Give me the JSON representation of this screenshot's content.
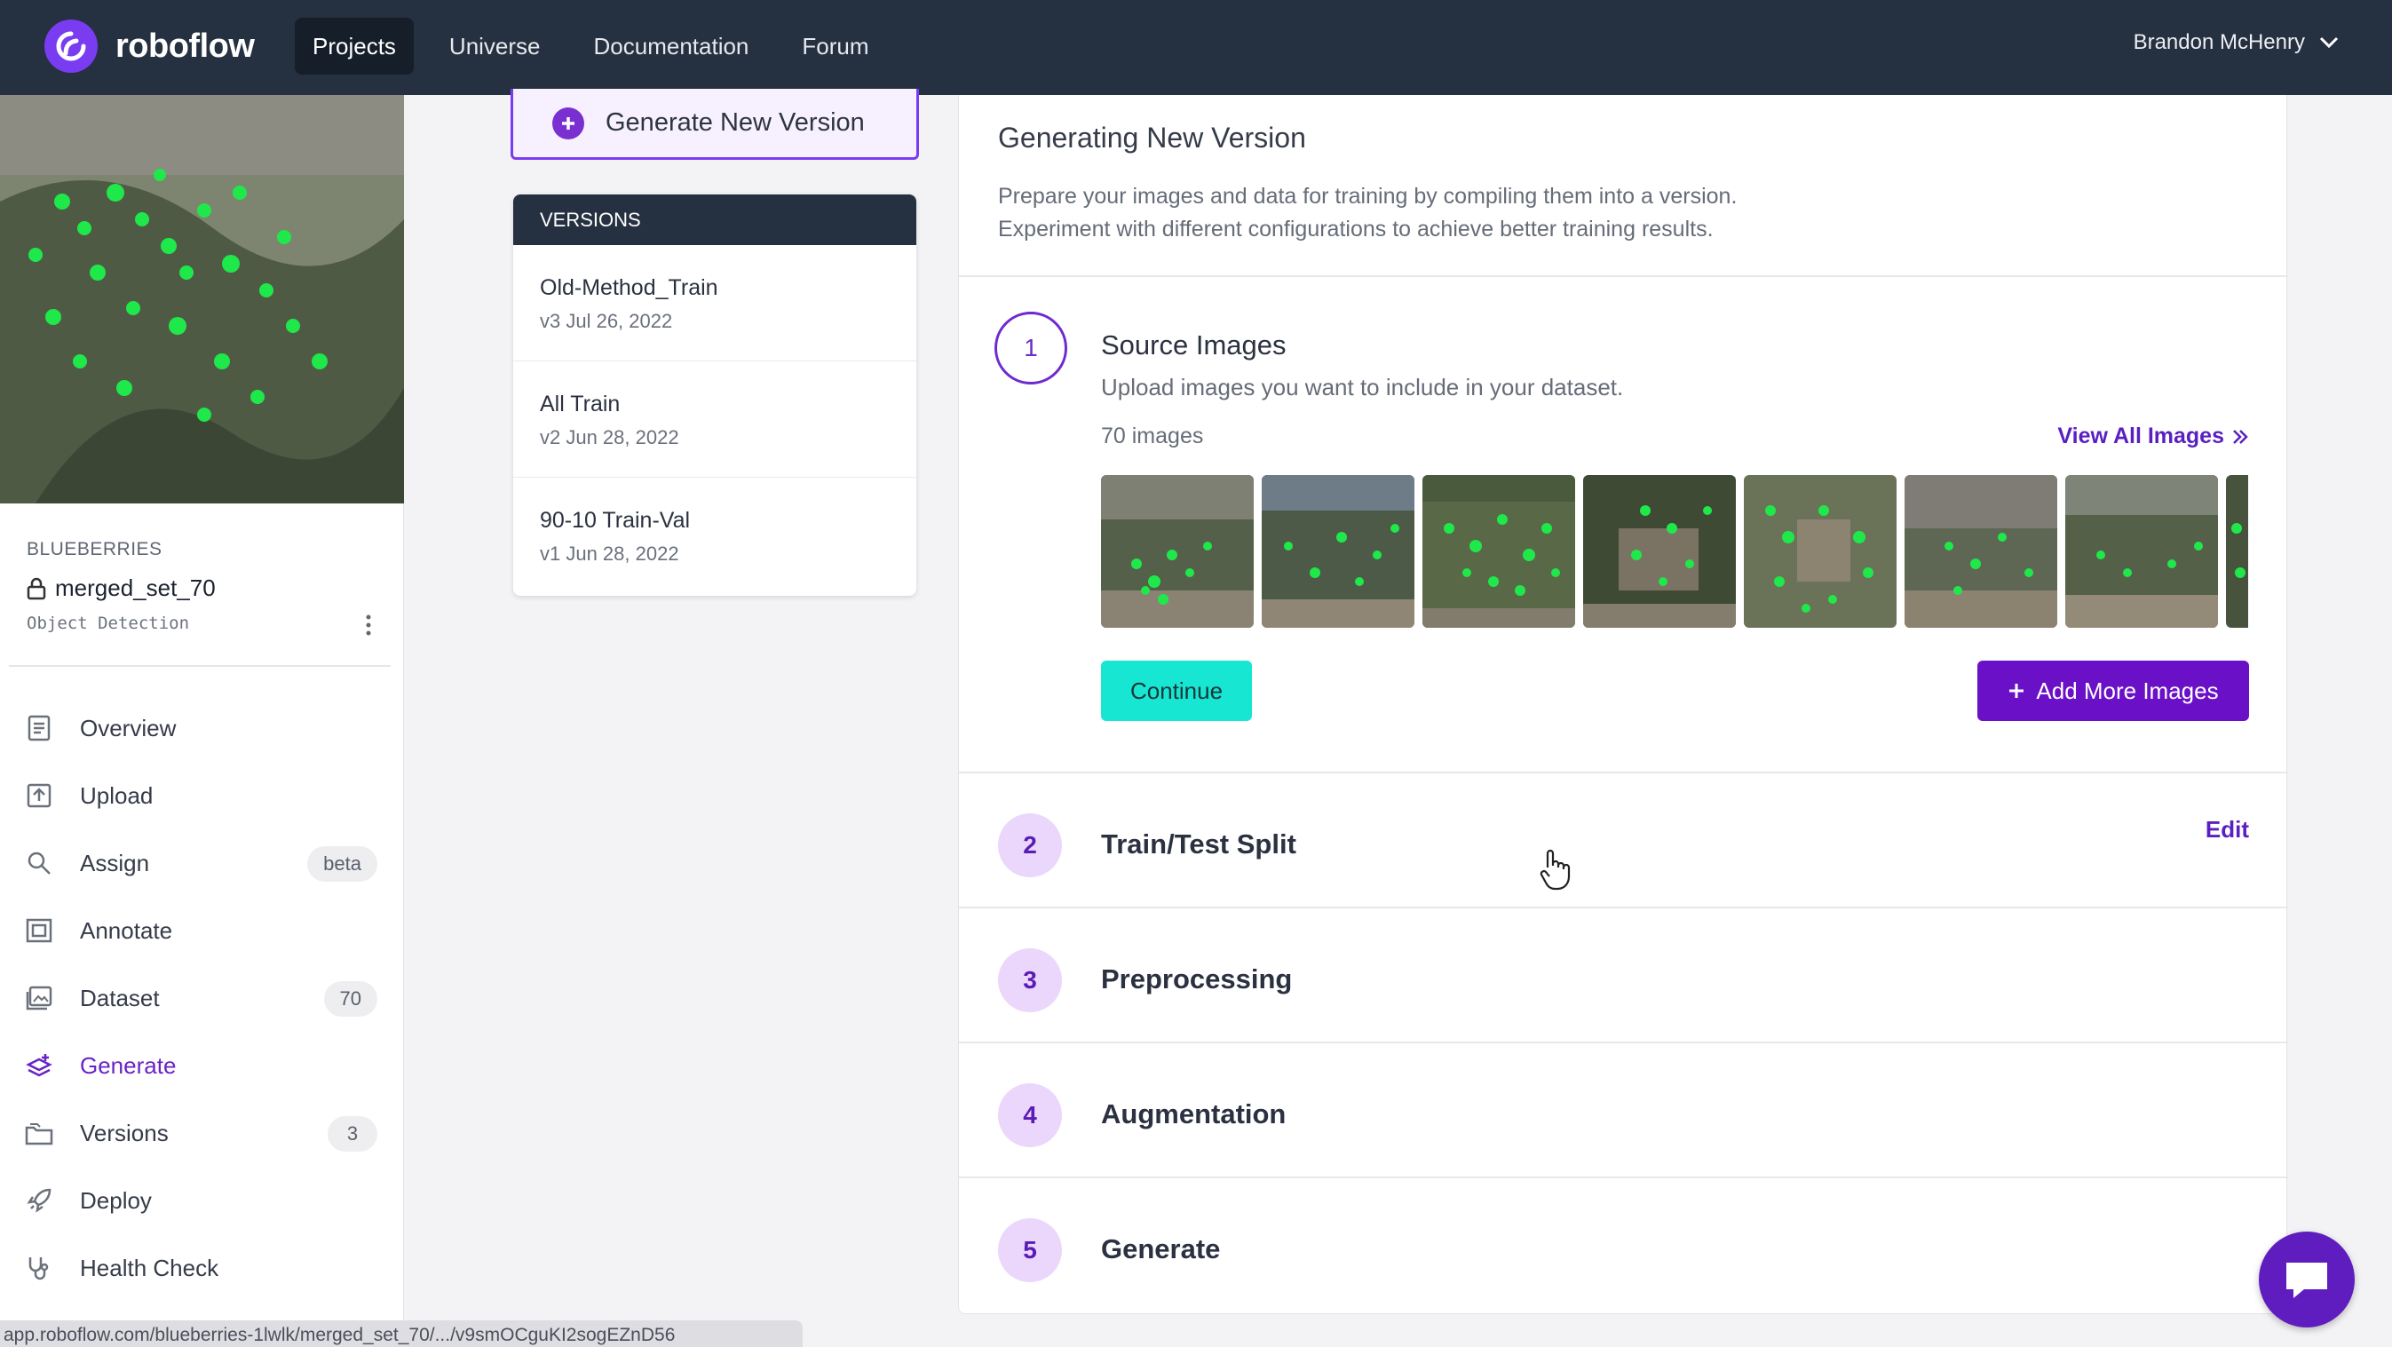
{
  "topbar": {
    "brand": "roboflow",
    "nav": [
      "Projects",
      "Universe",
      "Documentation",
      "Forum"
    ],
    "active_nav": "Projects",
    "user_name": "Brandon McHenry"
  },
  "sidebar": {
    "project_category": "BLUEBERRIES",
    "project_name": "merged_set_70",
    "project_type": "Object Detection",
    "items": [
      {
        "label": "Overview",
        "icon": "overview-icon",
        "badge": ""
      },
      {
        "label": "Upload",
        "icon": "upload-icon",
        "badge": ""
      },
      {
        "label": "Assign",
        "icon": "search-icon",
        "badge": "beta"
      },
      {
        "label": "Annotate",
        "icon": "annotate-icon",
        "badge": ""
      },
      {
        "label": "Dataset",
        "icon": "dataset-icon",
        "badge": "70"
      },
      {
        "label": "Generate",
        "icon": "generate-icon",
        "badge": ""
      },
      {
        "label": "Versions",
        "icon": "versions-icon",
        "badge": "3"
      },
      {
        "label": "Deploy",
        "icon": "rocket-icon",
        "badge": ""
      },
      {
        "label": "Health Check",
        "icon": "stethoscope-icon",
        "badge": ""
      }
    ],
    "active_item": "Generate"
  },
  "versions": {
    "generate_button": "Generate New Version",
    "header": "VERSIONS",
    "list": [
      {
        "name": "Old-Method_Train",
        "meta": "v3 Jul 26, 2022"
      },
      {
        "name": "All Train",
        "meta": "v2 Jun 28, 2022"
      },
      {
        "name": "90-10 Train-Val",
        "meta": "v1 Jun 28, 2022"
      }
    ]
  },
  "main": {
    "title": "Generating New Version",
    "description_line1": "Prepare your images and data for training by compiling them into a version.",
    "description_line2": "Experiment with different configurations to achieve better training results.",
    "steps": [
      {
        "number": "1",
        "title": "Source Images",
        "subtitle": "Upload images you want to include in your dataset."
      },
      {
        "number": "2",
        "title": "Train/Test Split"
      },
      {
        "number": "3",
        "title": "Preprocessing"
      },
      {
        "number": "4",
        "title": "Augmentation"
      },
      {
        "number": "5",
        "title": "Generate"
      }
    ],
    "image_count": "70 images",
    "view_all": "View All Images",
    "continue_label": "Continue",
    "add_images_label": "Add More Images",
    "edit_label": "Edit"
  },
  "statusbar": {
    "url": "app.roboflow.com/blueberries-1lwlk/merged_set_70/.../v9smOCguKI2sogEZnD56"
  },
  "colors": {
    "nav_bg": "#253040",
    "accent_purple": "#6a11c8",
    "continue_teal": "#17e6d2",
    "label_green": "#1fe84a"
  }
}
